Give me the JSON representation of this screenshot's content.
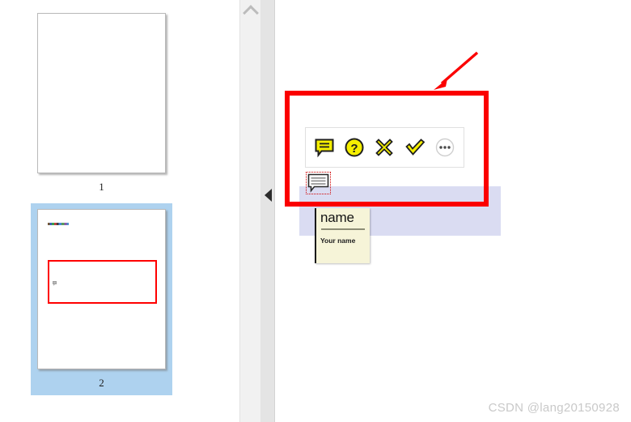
{
  "thumbnails": {
    "panel_name": "page-thumbnails",
    "pages": [
      {
        "label": "1",
        "selected": false,
        "has_annotation": false
      },
      {
        "label": "2",
        "selected": true,
        "has_annotation": true
      }
    ]
  },
  "scrollbar": {
    "up_arrow_icon": "chevron-up-icon"
  },
  "splitter": {
    "collapse_icon": "triangle-left-icon"
  },
  "annotation_toolbar": {
    "buttons": [
      {
        "name": "add-comment-button",
        "icon": "speech-bubble-icon",
        "color": "#f5ef00"
      },
      {
        "name": "help-button",
        "icon": "question-mark-circle-icon",
        "color": "#f5ef00"
      },
      {
        "name": "reject-button",
        "icon": "cross-x-icon",
        "color": "#f5ef00"
      },
      {
        "name": "accept-button",
        "icon": "check-mark-icon",
        "color": "#f5ef00"
      },
      {
        "name": "more-options-button",
        "icon": "ellipsis-circle-icon",
        "color": "#9a9a9a"
      }
    ]
  },
  "comment_marker": {
    "icon": "comment-note-icon",
    "selected": true
  },
  "note_popup": {
    "title": "name",
    "body": "Your name"
  },
  "callout": {
    "box_color": "#fb0000",
    "arrow_icon": "arrow-down-left-icon"
  },
  "watermark": {
    "text": "CSDN @lang20150928"
  },
  "colors": {
    "selection_blue": "#aed2ef",
    "highlight_lavender": "#dadcf2",
    "annotation_red": "#ff0000",
    "icon_yellow": "#f5ef00",
    "note_yellow": "#f6f4d8"
  }
}
